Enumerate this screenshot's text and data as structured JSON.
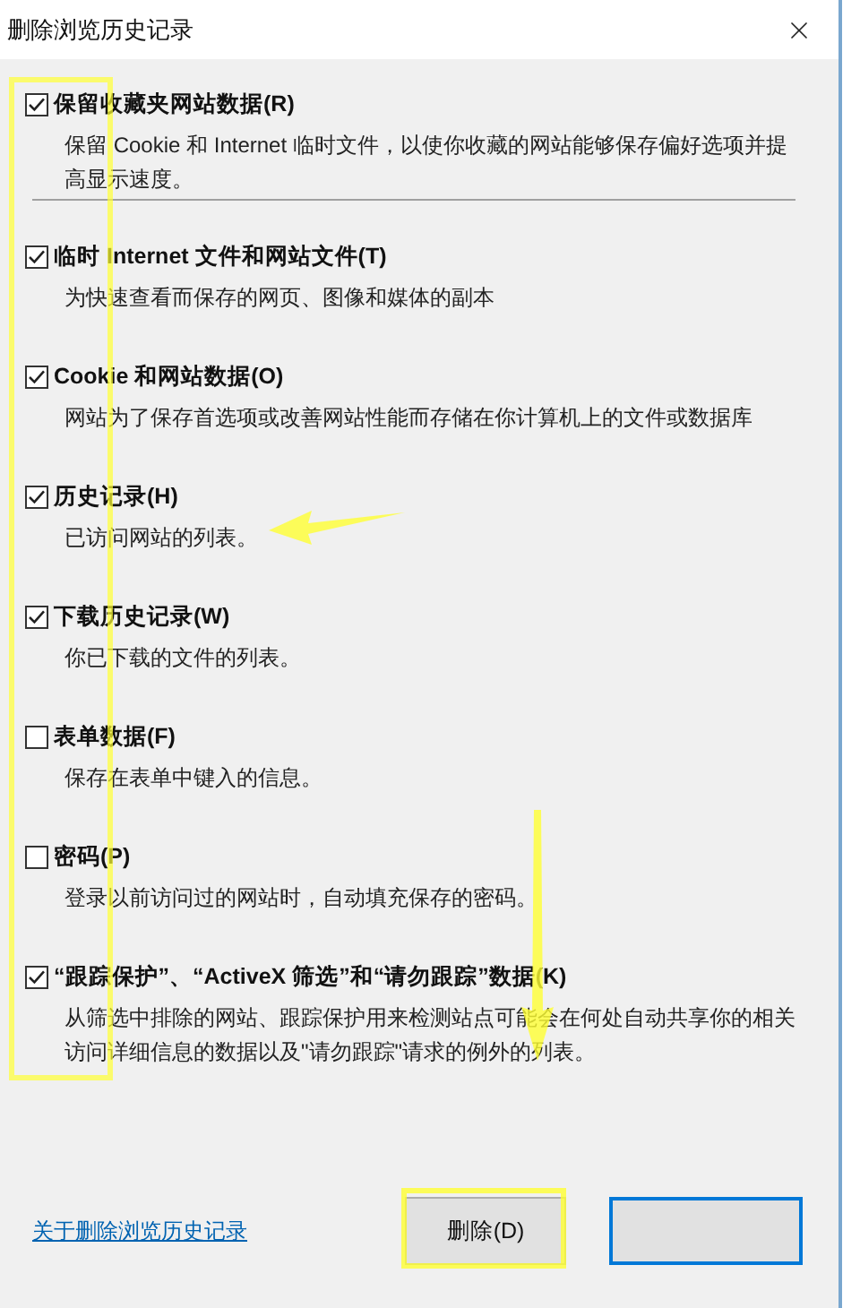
{
  "window": {
    "title": "删除浏览历史记录"
  },
  "options": [
    {
      "label": "保留收藏夹网站数据(R)",
      "description": "保留 Cookie 和 Internet 临时文件，以使你收藏的网站能够保存偏好选项并提高显示速度。",
      "checked": true
    },
    {
      "label": "临时 Internet 文件和网站文件(T)",
      "description": "为快速查看而保存的网页、图像和媒体的副本",
      "checked": true
    },
    {
      "label": "Cookie 和网站数据(O)",
      "description": "网站为了保存首选项或改善网站性能而存储在你计算机上的文件或数据库",
      "checked": true
    },
    {
      "label": "历史记录(H)",
      "description": "已访问网站的列表。",
      "checked": true
    },
    {
      "label": "下载历史记录(W)",
      "description": "你已下载的文件的列表。",
      "checked": true
    },
    {
      "label": "表单数据(F)",
      "description": "保存在表单中键入的信息。",
      "checked": false
    },
    {
      "label": "密码(P)",
      "description": "登录以前访问过的网站时，自动填充保存的密码。",
      "checked": false
    },
    {
      "label": "“跟踪保护”、“ActiveX 筛选”和“请勿跟踪”数据(K)",
      "description": "从筛选中排除的网站、跟踪保护用来检测站点可能会在何处自动共享你的相关访问详细信息的数据以及\"请勿跟踪\"请求的例外的列表。",
      "checked": true
    }
  ],
  "footer": {
    "link": "关于删除浏览历史记录",
    "delete_button": "删除(D)"
  }
}
